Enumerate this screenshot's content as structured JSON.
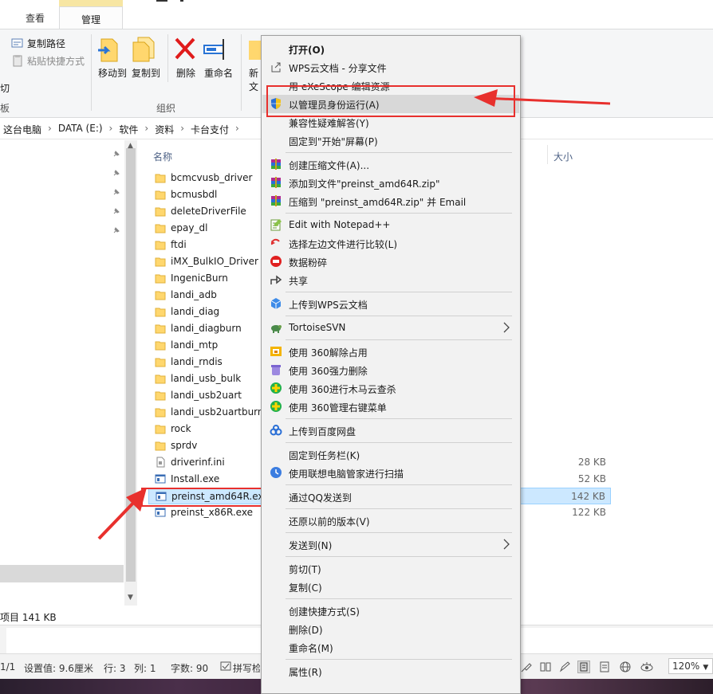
{
  "ribbon": {
    "tabs": {
      "view": "查看",
      "manage": "管理",
      "manage_tools": "应用程序工具"
    },
    "copy_path": "复制路径",
    "paste_shortcut": "粘贴快捷方式",
    "cut_partial": "切",
    "clipboard_partial": "板",
    "move_to": "移动到",
    "copy_to": "复制到",
    "delete": "删除",
    "rename": "重命名",
    "new_partial_1": "新",
    "new_partial_2": "文",
    "organize": "组织"
  },
  "breadcrumb": [
    "这台电脑",
    "DATA (E:)",
    "软件",
    "资料",
    "卡台支付"
  ],
  "columns": {
    "name": "名称",
    "size": "大小"
  },
  "files": [
    {
      "name": "bcmcvusb_driver",
      "type": "folder",
      "size": ""
    },
    {
      "name": "bcmusbdl",
      "type": "folder",
      "size": ""
    },
    {
      "name": "deleteDriverFile",
      "type": "folder",
      "size": ""
    },
    {
      "name": "epay_dl",
      "type": "folder",
      "size": ""
    },
    {
      "name": "ftdi",
      "type": "folder",
      "size": ""
    },
    {
      "name": "iMX_BulkIO_Driver",
      "type": "folder",
      "size": ""
    },
    {
      "name": "IngenicBurn",
      "type": "folder",
      "size": ""
    },
    {
      "name": "landi_adb",
      "type": "folder",
      "size": ""
    },
    {
      "name": "landi_diag",
      "type": "folder",
      "size": ""
    },
    {
      "name": "landi_diagburn",
      "type": "folder",
      "size": ""
    },
    {
      "name": "landi_mtp",
      "type": "folder",
      "size": ""
    },
    {
      "name": "landi_rndis",
      "type": "folder",
      "size": ""
    },
    {
      "name": "landi_usb_bulk",
      "type": "folder",
      "size": ""
    },
    {
      "name": "landi_usb2uart",
      "type": "folder",
      "size": ""
    },
    {
      "name": "landi_usb2uartburn",
      "type": "folder",
      "size": ""
    },
    {
      "name": "rock",
      "type": "folder",
      "size": ""
    },
    {
      "name": "sprdv",
      "type": "folder",
      "size": ""
    },
    {
      "name": "driverinf.ini",
      "type": "ini",
      "size": "28 KB"
    },
    {
      "name": "Install.exe",
      "type": "exe",
      "size": "52 KB"
    },
    {
      "name": "preinst_amd64R.exe",
      "type": "exe",
      "size": "142 KB",
      "selected": true
    },
    {
      "name": "preinst_x86R.exe",
      "type": "exe",
      "size": "122 KB"
    }
  ],
  "status": {
    "text": "项目  141 KB"
  },
  "writer_status": {
    "page": "1/1",
    "setting": "设置值: 9.6厘米",
    "line": "行: 3",
    "col": "列: 1",
    "chars": "字数: 90",
    "spell": "拼写检",
    "zoom": "120%"
  },
  "context_menu": [
    {
      "label": "打开(O)",
      "bold": true,
      "icon": ""
    },
    {
      "label": "WPS云文档 - 分享文件",
      "icon": "share-out-icon"
    },
    {
      "label": "用 eXeScope 编辑资源",
      "icon": ""
    },
    {
      "label": "以管理员身份运行(A)",
      "icon": "uac-shield-icon",
      "highlighted": true
    },
    {
      "label": "兼容性疑难解答(Y)",
      "icon": ""
    },
    {
      "label": "固定到\"开始\"屏幕(P)",
      "icon": ""
    },
    {
      "sep": true
    },
    {
      "label": "创建压缩文件(A)...",
      "icon": "winrar-icon"
    },
    {
      "label": "添加到文件\"preinst_amd64R.zip\"",
      "icon": "winrar-icon"
    },
    {
      "label": "压缩到 \"preinst_amd64R.zip\" 并 Email",
      "icon": "winrar-icon"
    },
    {
      "sep": true
    },
    {
      "label": "Edit with Notepad++",
      "icon": "notepadpp-icon"
    },
    {
      "label": "选择左边文件进行比较(L)",
      "icon": "compare-icon"
    },
    {
      "label": "数据粉碎",
      "icon": "shred-icon"
    },
    {
      "label": "共享",
      "icon": "share-icon"
    },
    {
      "sep": true
    },
    {
      "label": "上传到WPS云文档",
      "icon": "wps-cloud-icon"
    },
    {
      "sep": true
    },
    {
      "label": "TortoiseSVN",
      "icon": "tortoise-icon",
      "submenu": true
    },
    {
      "sep": true
    },
    {
      "label": "使用 360解除占用",
      "icon": "360-unlock-icon"
    },
    {
      "label": "使用 360强力删除",
      "icon": "360-delete-icon"
    },
    {
      "label": "使用 360进行木马云查杀",
      "icon": "360-scan-icon"
    },
    {
      "label": "使用 360管理右键菜单",
      "icon": "360-menu-icon"
    },
    {
      "sep": true
    },
    {
      "label": "上传到百度网盘",
      "icon": "baidu-cloud-icon"
    },
    {
      "sep": true
    },
    {
      "label": "固定到任务栏(K)",
      "icon": ""
    },
    {
      "label": "使用联想电脑管家进行扫描",
      "icon": "lenovo-scan-icon"
    },
    {
      "sep": true
    },
    {
      "label": "通过QQ发送到",
      "icon": ""
    },
    {
      "sep": true
    },
    {
      "label": "还原以前的版本(V)",
      "icon": ""
    },
    {
      "sep": true
    },
    {
      "label": "发送到(N)",
      "icon": "",
      "submenu": true
    },
    {
      "sep": true
    },
    {
      "label": "剪切(T)",
      "icon": ""
    },
    {
      "label": "复制(C)",
      "icon": ""
    },
    {
      "sep": true
    },
    {
      "label": "创建快捷方式(S)",
      "icon": ""
    },
    {
      "label": "删除(D)",
      "icon": ""
    },
    {
      "label": "重命名(M)",
      "icon": ""
    },
    {
      "sep": true
    },
    {
      "label": "属性(R)",
      "icon": ""
    }
  ],
  "colors": {
    "annotation_red": "#e8302d",
    "selection": "#cce8ff",
    "menu_bg": "#f2f2f2"
  }
}
